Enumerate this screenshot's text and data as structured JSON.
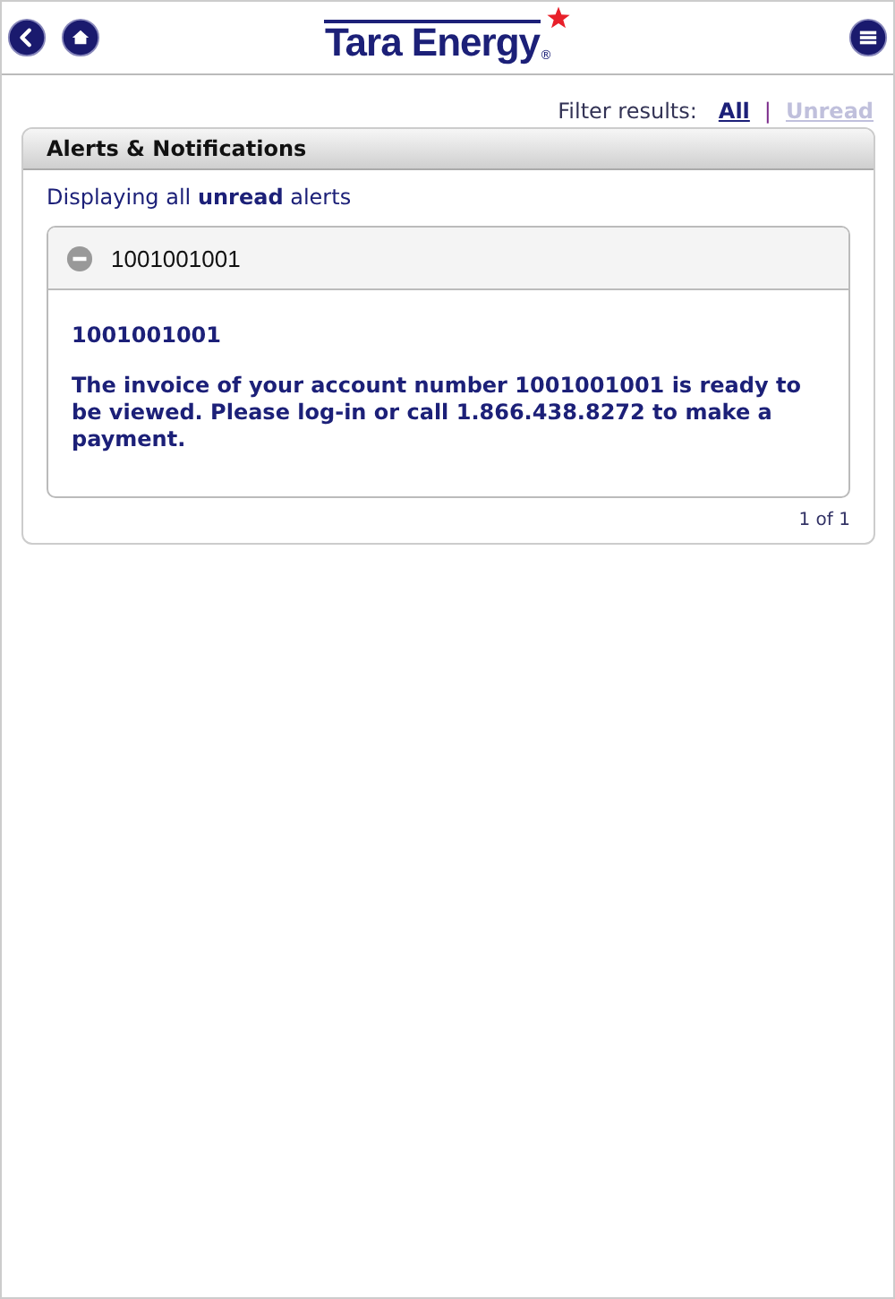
{
  "header": {
    "logo": "Tara Energy",
    "logo_mark": "®"
  },
  "filter": {
    "label": "Filter results:",
    "separator": "|",
    "options": [
      {
        "label": "All",
        "selected": true
      },
      {
        "label": "Unread",
        "selected": false
      }
    ]
  },
  "panel": {
    "title": "Alerts & Notifications",
    "description": "Displaying all **unread** alerts",
    "alerts": [
      {
        "title": "1001001001",
        "expanded": true,
        "heading": "1001001001",
        "message": "The invoice of your account number 1001001001 is ready to be viewed. Please log-in or call 1.866.438.8272 to make a payment."
      }
    ],
    "pagination": "1 of 1"
  }
}
